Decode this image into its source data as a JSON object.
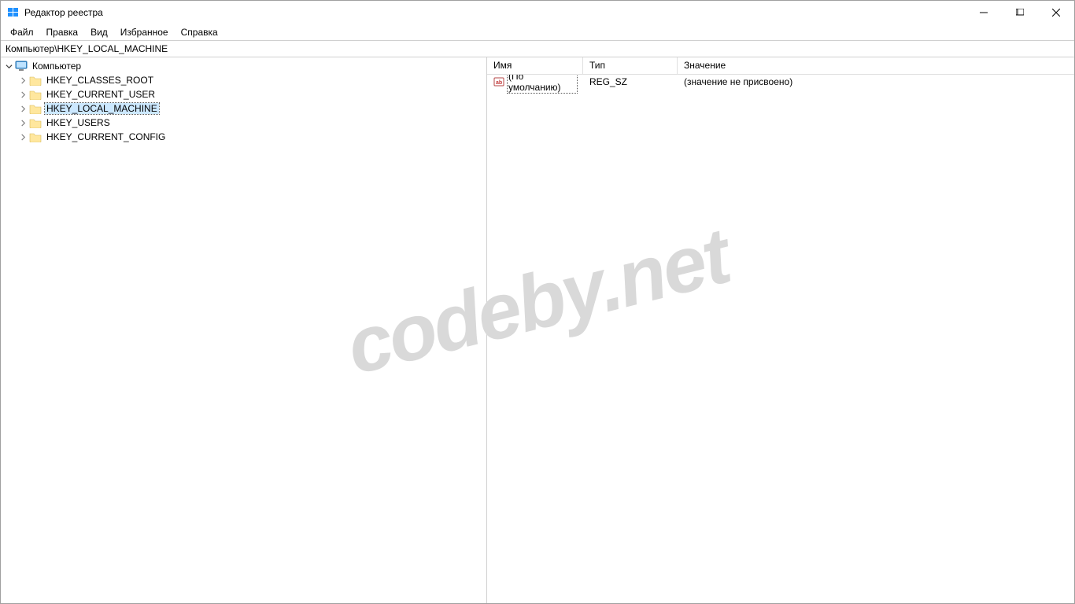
{
  "window": {
    "title": "Редактор реестра"
  },
  "menubar": {
    "items": [
      "Файл",
      "Правка",
      "Вид",
      "Избранное",
      "Справка"
    ]
  },
  "addressbar": {
    "path": "Компьютер\\HKEY_LOCAL_MACHINE"
  },
  "tree": {
    "root": {
      "label": "Компьютер",
      "expanded": true,
      "icon": "computer"
    },
    "hives": [
      {
        "label": "HKEY_CLASSES_ROOT",
        "selected": false
      },
      {
        "label": "HKEY_CURRENT_USER",
        "selected": false
      },
      {
        "label": "HKEY_LOCAL_MACHINE",
        "selected": true
      },
      {
        "label": "HKEY_USERS",
        "selected": false
      },
      {
        "label": "HKEY_CURRENT_CONFIG",
        "selected": false
      }
    ]
  },
  "values": {
    "columns": {
      "name": "Имя",
      "type": "Тип",
      "value": "Значение"
    },
    "rows": [
      {
        "name": "(По умолчанию)",
        "type": "REG_SZ",
        "value": "(значение не присвоено)",
        "icon": "reg-string",
        "focused": true
      }
    ]
  },
  "watermark": "codeby.net"
}
